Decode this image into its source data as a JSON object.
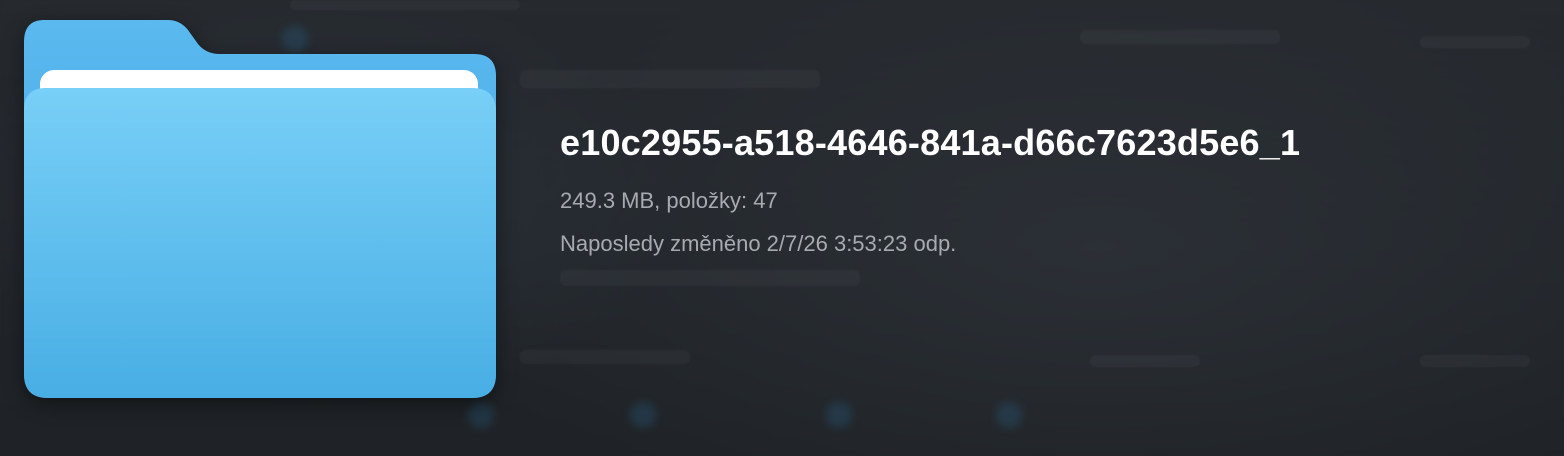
{
  "preview": {
    "icon": "folder-icon",
    "accent_color": "#5bbcf0",
    "name": "e10c2955-a518-4646-841a-d66c7623d5e6_1",
    "size_items": "249.3 MB, položky: 47",
    "modified": "Naposledy změněno 2/7/26 3:53:23 odp."
  }
}
